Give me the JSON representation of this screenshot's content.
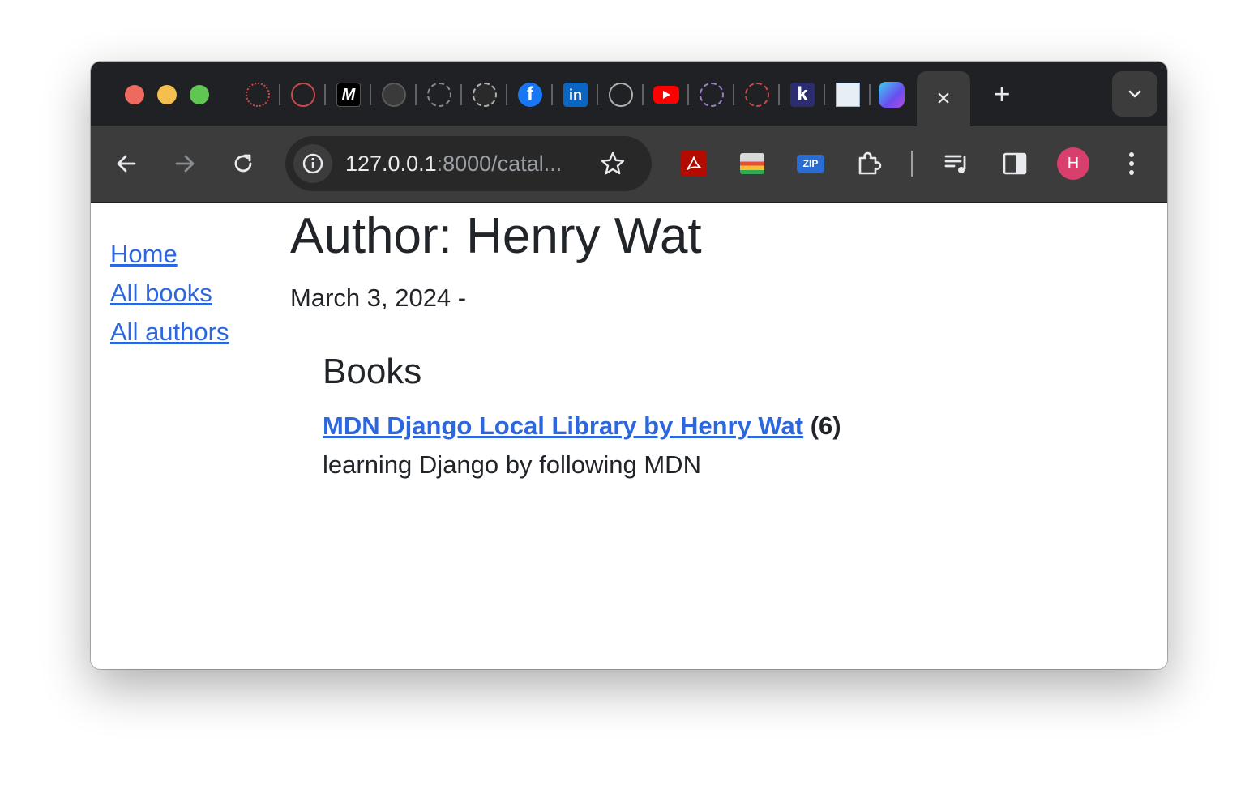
{
  "browser": {
    "active_tab_close": "×",
    "new_tab": "+",
    "pinned_tabs": [
      {
        "icon": "target-icon"
      },
      {
        "icon": "robot-icon"
      },
      {
        "icon": "medium-icon",
        "label": "M"
      },
      {
        "icon": "github-icon"
      },
      {
        "icon": "loading-ring-icon"
      },
      {
        "icon": "netflix-ring-icon"
      },
      {
        "icon": "facebook-icon",
        "label": "f",
        "color": "#1877f2"
      },
      {
        "icon": "linkedin-icon",
        "label": "in",
        "color": "#0a66c2"
      },
      {
        "icon": "info-ring-icon"
      },
      {
        "icon": "youtube-icon",
        "color": "#ff0000"
      },
      {
        "icon": "chart-ring-icon"
      },
      {
        "icon": "runner-ring-icon"
      },
      {
        "icon": "k-icon",
        "label": "k",
        "color": "#2b2d6e"
      },
      {
        "icon": "document-thumb-icon"
      },
      {
        "icon": "app-gradient-icon"
      }
    ],
    "url_host": "127.0.0.1",
    "url_rest": ":8000/catal...",
    "profile_initial": "H",
    "extensions": [
      {
        "icon": "acrobat-icon",
        "color": "#b30b00"
      },
      {
        "icon": "screenshot-icon"
      },
      {
        "icon": "zip-icon",
        "label": "ZIP",
        "color": "#2b6cd2"
      },
      {
        "icon": "puzzle-icon"
      }
    ]
  },
  "nav": {
    "items": [
      {
        "label": "Home"
      },
      {
        "label": "All books"
      },
      {
        "label": "All authors"
      }
    ]
  },
  "author": {
    "heading": "Author: Henry Wat",
    "dates": "March 3, 2024 -"
  },
  "books": {
    "heading": "Books",
    "items": [
      {
        "title": "MDN Django Local Library by Henry Wat",
        "count": "(6)",
        "summary": "learning Django by following MDN"
      }
    ]
  }
}
